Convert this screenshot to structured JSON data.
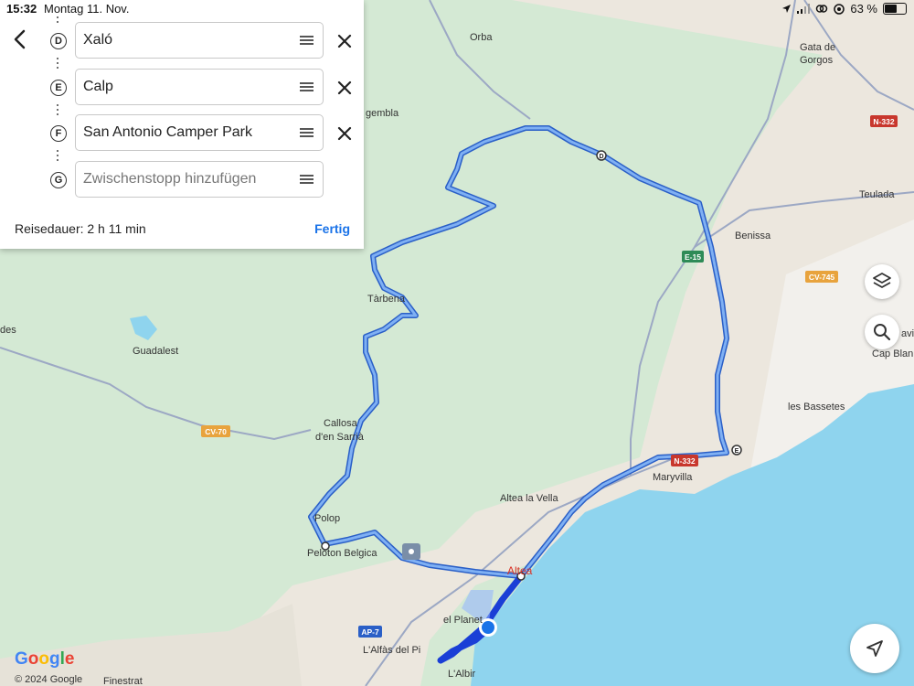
{
  "status_bar": {
    "time": "15:32",
    "date": "Montag 11. Nov.",
    "battery": "63 %",
    "battery_level": 0.63
  },
  "route_panel": {
    "stops": [
      {
        "marker": "D",
        "value": "Xaló",
        "placeholder": ""
      },
      {
        "marker": "E",
        "value": "Calp",
        "placeholder": ""
      },
      {
        "marker": "F",
        "value": "San Antonio Camper Park",
        "placeholder": ""
      },
      {
        "marker": "G",
        "value": "",
        "placeholder": "Zwischenstopp hinzufügen"
      }
    ],
    "duration": "Reisedauer: 2 h 11 min",
    "done_label": "Fertig"
  },
  "map": {
    "place_labels": [
      "Orba",
      "Gata de",
      "Gorgos",
      "Benissa",
      "Teulada",
      "Tàrbena",
      "Guadalest",
      "Callosa",
      "d'en Sarrià",
      "Polop",
      "Altea la Vella",
      "Maryvilla",
      "les Bassetes",
      "Cap Blan",
      "Peloton Belgica",
      "el Planet",
      "L'Alfàs del Pi",
      "L'Albir",
      "Finestrat",
      "Altea",
      "gembla",
      "des",
      "avit"
    ],
    "road_badges": [
      "N-332",
      "E-15",
      "CV-745",
      "CV-70",
      "N-332",
      "AP-7"
    ],
    "colors": {
      "route": "#4d8ce8",
      "route_active": "#1a3fd6",
      "sea": "#8fd4ee",
      "terrain": "#d9ecd8",
      "land": "#ece8e1",
      "accent": "#1a73e8",
      "badge_red": "#c8372d",
      "badge_green": "#2e8b57",
      "badge_orange": "#e8a33d"
    }
  },
  "attribution": {
    "logo": "Google",
    "copyright": "© 2024 Google"
  }
}
